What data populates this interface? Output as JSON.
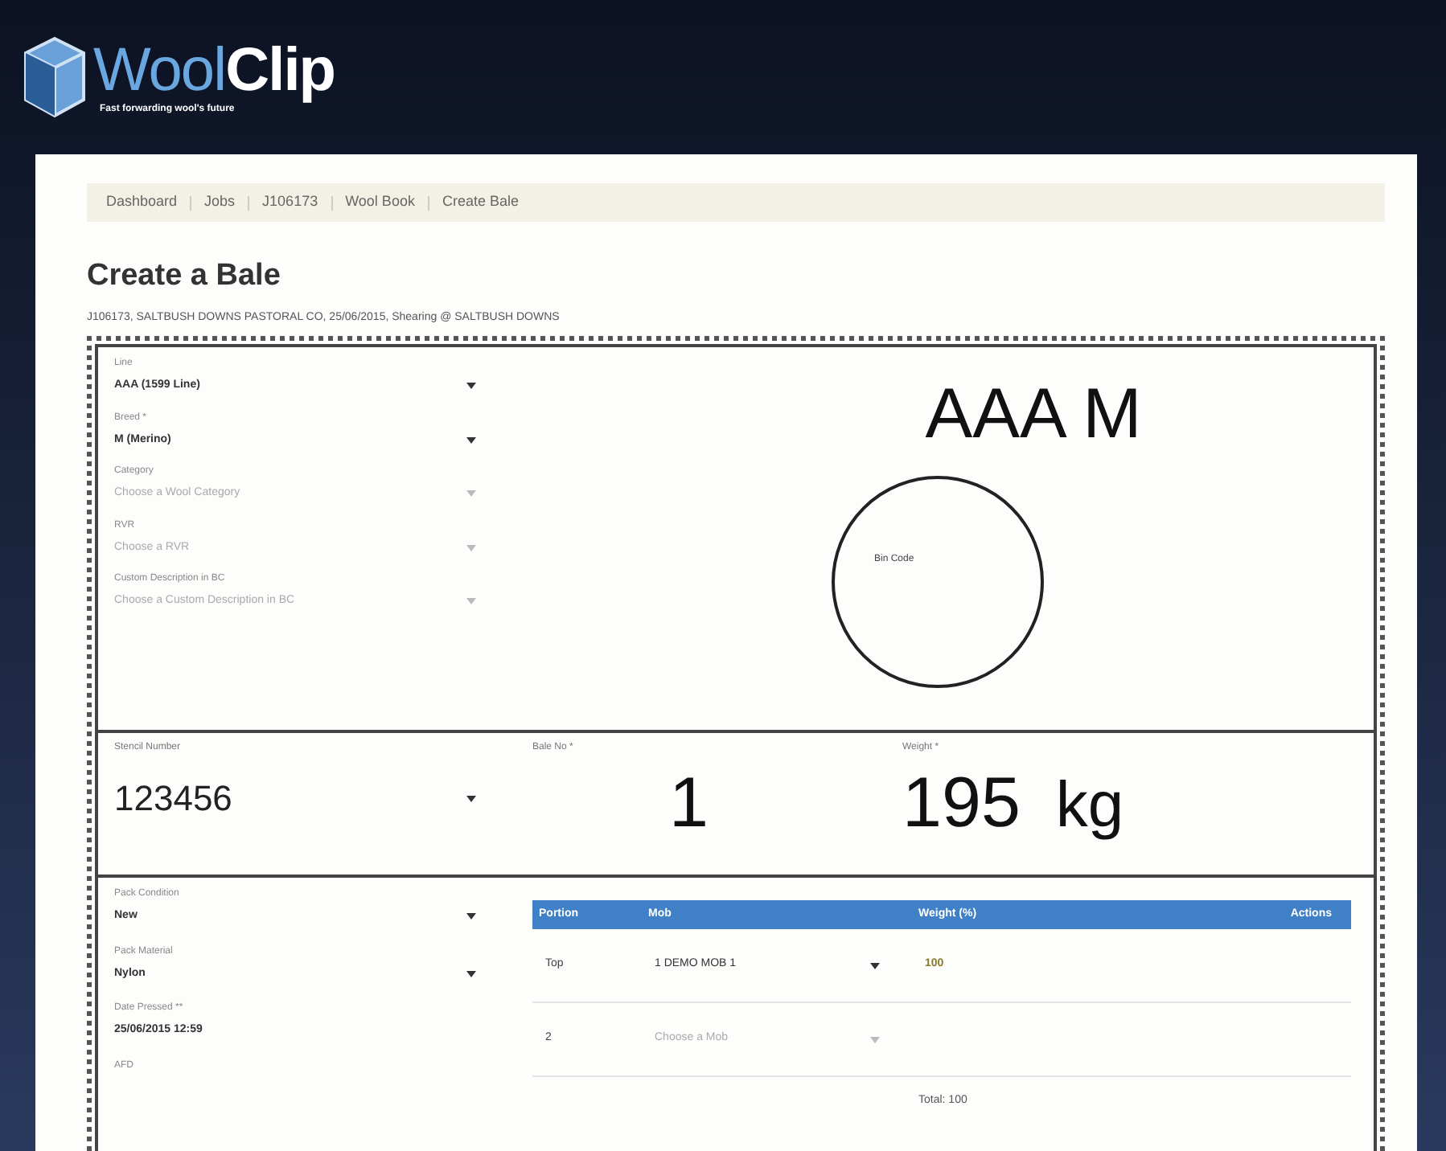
{
  "header": {
    "logo_light": "Wool",
    "logo_bold": "Clip",
    "tagline": "Fast forwarding wool's future"
  },
  "breadcrumb": [
    "Dashboard",
    "Jobs",
    "J106173",
    "Wool Book",
    "Create Bale"
  ],
  "title": "Create a Bale",
  "subtitle": "J106173, SALTBUSH DOWNS PASTORAL CO, 25/06/2015, Shearing @ SALTBUSH DOWNS",
  "top_fields": [
    {
      "label": "Line",
      "value": "AAA (1599 Line)"
    },
    {
      "label": "Breed *",
      "value": "M (Merino)"
    },
    {
      "label": "Category",
      "placeholder": "Choose a Wool Category"
    },
    {
      "label": "RVR",
      "placeholder": "Choose a RVR"
    },
    {
      "label": "Custom Description in BC",
      "placeholder": "Choose a Custom Description in BC"
    }
  ],
  "bale_code": "AAA M",
  "circle_label": "Bin Code",
  "stencil": {
    "label": "Stencil Number",
    "value": "123456"
  },
  "bale_no": {
    "label": "Bale No *",
    "value": "1"
  },
  "weight": {
    "label": "Weight *",
    "value": "195",
    "unit": "kg"
  },
  "pack_fields": [
    {
      "kind": "select",
      "label": "Pack Condition",
      "value": "New"
    },
    {
      "kind": "select",
      "label": "Pack Material",
      "value": "Nylon"
    },
    {
      "kind": "text",
      "label": "Date Pressed **",
      "value": "25/06/2015 12:59"
    },
    {
      "kind": "text",
      "label": "AFD"
    }
  ],
  "mob_table": {
    "columns": [
      "Portion",
      "Mob",
      "Weight (%)",
      "Actions"
    ],
    "rows": [
      {
        "portion": "Top",
        "mob": "1 DEMO MOB 1",
        "weight": "100"
      },
      {
        "portion": "2",
        "mob_placeholder": "Choose a Mob"
      }
    ],
    "total": "Total: 100"
  }
}
